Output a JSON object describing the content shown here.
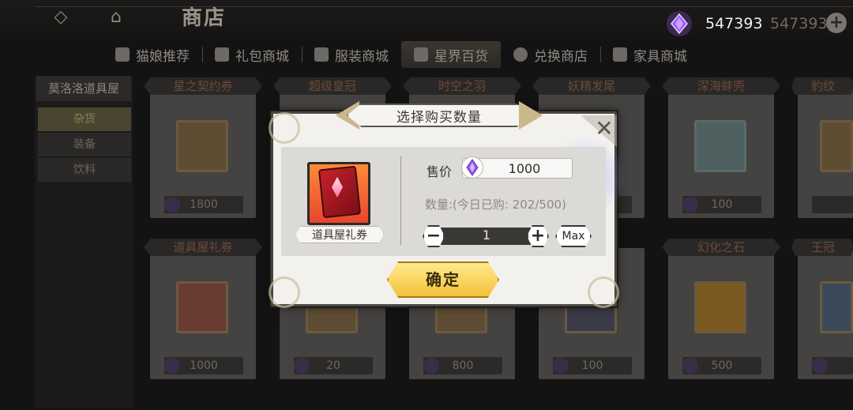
{
  "header": {
    "title": "商店",
    "currency_amount": "547393",
    "currency_amount_ghost": "547393",
    "add_symbol": "+",
    "back_icon": "back-icon",
    "home_icon": "home-icon"
  },
  "tabs": [
    {
      "label": "猫娘推荐",
      "icon": "cat-icon"
    },
    {
      "label": "礼包商城",
      "icon": "gift-icon"
    },
    {
      "label": "服装商城",
      "icon": "clothes-icon"
    },
    {
      "label": "星界百货",
      "icon": "star-shop-icon",
      "active": true
    },
    {
      "label": "兑换商店",
      "icon": "exchange-icon"
    },
    {
      "label": "家具商城",
      "icon": "furniture-icon"
    }
  ],
  "sidebar": {
    "shop_name": "莫洛洛道具屋",
    "items": [
      {
        "label": "杂货",
        "active": true
      },
      {
        "label": "装备"
      },
      {
        "label": "饮料"
      }
    ]
  },
  "cards": [
    {
      "name": "星之契约券",
      "price": "1800"
    },
    {
      "name": "超级皇冠",
      "price": ""
    },
    {
      "name": "时空之羽",
      "price": ""
    },
    {
      "name": "妖精发尾",
      "price": ""
    },
    {
      "name": "深海蚌壳",
      "price": "100"
    },
    {
      "name": "豹纹",
      "price": ""
    },
    {
      "name": "道具屋礼券",
      "price": "1000"
    },
    {
      "name": "",
      "price": "20"
    },
    {
      "name": "",
      "price": "800"
    },
    {
      "name": "",
      "price": "100"
    },
    {
      "name": "幻化之石",
      "price": "500"
    },
    {
      "name": "王冠",
      "price": ""
    }
  ],
  "dialog": {
    "title": "选择购买数量",
    "item_name": "道具屋礼券",
    "price_label": "售价",
    "price_value": "1000",
    "quantity_text": "数量:(今日已购: 202/500)",
    "quantity_value": "1",
    "minus": "−",
    "plus": "+",
    "max_label": "Max",
    "confirm_label": "确定",
    "close_symbol": "✕"
  },
  "colors": {
    "accent_gold": "#f3c33c",
    "gem_purple": "#8a4de0"
  }
}
